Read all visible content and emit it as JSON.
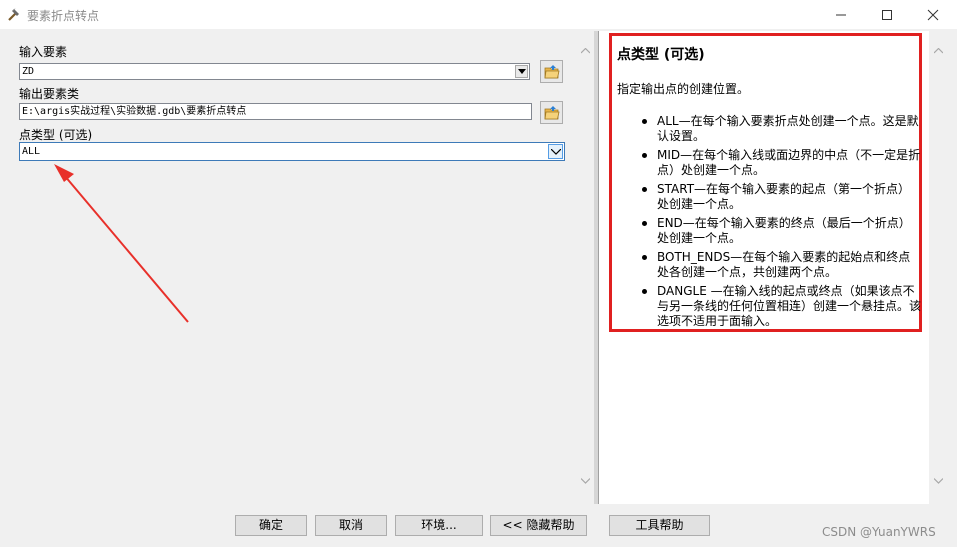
{
  "window": {
    "title": "要素折点转点",
    "controls": [
      "minimize",
      "maximize",
      "close"
    ]
  },
  "form": {
    "input_features": {
      "label": "输入要素",
      "value": "ZD"
    },
    "output_features": {
      "label": "输出要素类",
      "value": "E:\\argis实战过程\\实验数据.gdb\\要素折点转点"
    },
    "point_type": {
      "label": "点类型 (可选)",
      "value": "ALL"
    }
  },
  "help": {
    "title": "点类型 (可选)",
    "description": "指定输出点的创建位置。",
    "items": [
      "ALL—在每个输入要素折点处创建一个点。这是默认设置。",
      "MID—在每个输入线或面边界的中点（不一定是折点）处创建一个点。",
      "START—在每个输入要素的起点（第一个折点）处创建一个点。",
      "END—在每个输入要素的终点（最后一个折点）处创建一个点。",
      "BOTH_ENDS—在每个输入要素的起始点和终点处各创建一个点，共创建两个点。",
      "DANGLE —在输入线的起点或终点（如果该点不与另一条线的任何位置相连）创建一个悬挂点。该选项不适用于面输入。"
    ]
  },
  "buttons": {
    "ok": "确定",
    "cancel": "取消",
    "environments": "环境...",
    "hide_help": "<< 隐藏帮助",
    "tool_help": "工具帮助"
  },
  "watermark": "CSDN @YuanYWRS",
  "colors": {
    "highlight_border": "#e02020",
    "annotation_arrow": "#e8302a",
    "active_border": "#3d7ab8"
  }
}
